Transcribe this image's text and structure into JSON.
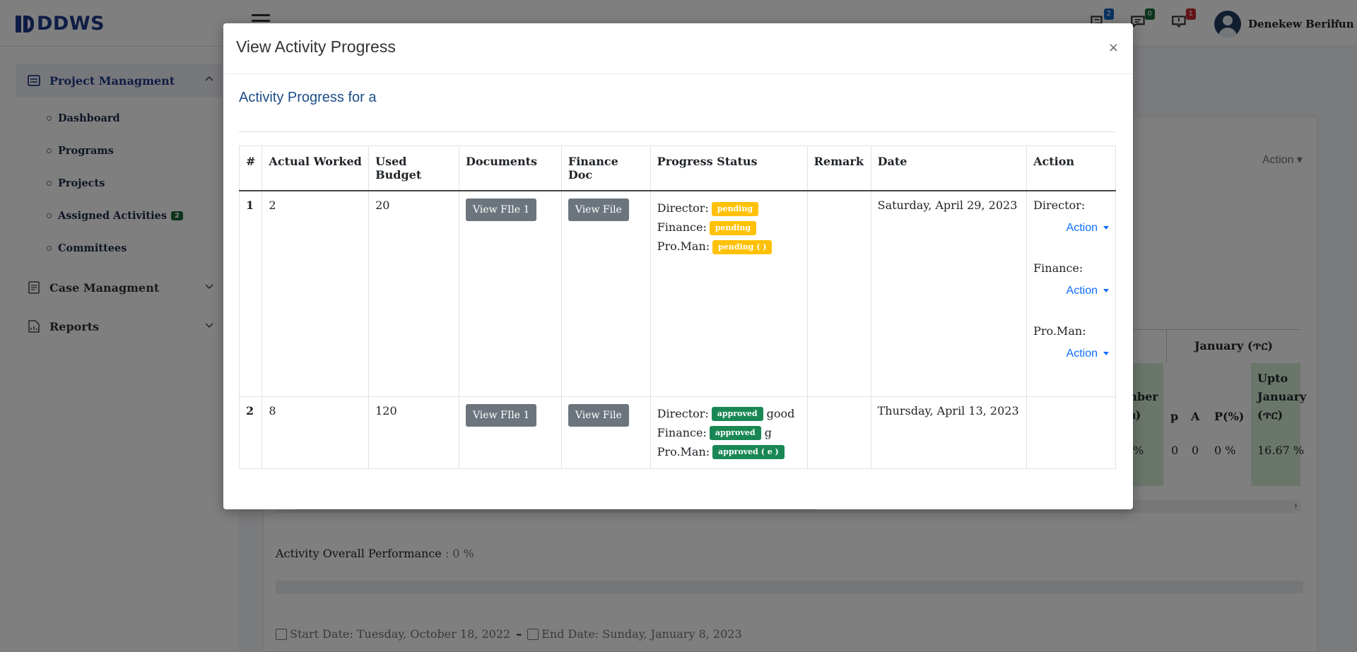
{
  "header": {
    "brand": "DDWS",
    "icons": [
      {
        "name": "chat-icon",
        "badge": "2",
        "color": "#1565c0"
      },
      {
        "name": "message-icon",
        "badge": "0",
        "color": "#1b6b37"
      },
      {
        "name": "notification-icon",
        "badge": "1",
        "color": "#c62828"
      }
    ],
    "user_name": "Denekew Berihun"
  },
  "sidebar": {
    "groups": [
      {
        "label": "Project Managment",
        "icon": "list-icon",
        "expanded": true
      },
      {
        "label": "Case Managment",
        "icon": "document-icon",
        "expanded": false
      },
      {
        "label": "Reports",
        "icon": "report-icon",
        "expanded": false
      }
    ],
    "items": [
      {
        "label": "Dashboard"
      },
      {
        "label": "Programs"
      },
      {
        "label": "Projects"
      },
      {
        "label": "Assigned Activities",
        "badge": "2"
      },
      {
        "label": "Committees"
      }
    ]
  },
  "background": {
    "action_label": "Action",
    "month_header": "January (ጥር)",
    "paren_header": ")",
    "col_number": "mber",
    "col_number2": "ክ)",
    "col_p": "p",
    "col_a": "A",
    "col_ppct": "P(%)",
    "col_upto_1": "Upto",
    "col_upto_2": "January",
    "col_upto_3": "(ጥር)",
    "val_pct1": "%",
    "val_p": "0",
    "val_a": "0",
    "val_ppct": "0 %",
    "val_upto": "16.67 %",
    "perf_label": "Activity Overall Performance",
    "perf_value": ": 0 %",
    "start_date": "Start Date: Tuesday, October 18, 2022",
    "end_date": "End Date: Sunday, January 8, 2023"
  },
  "modal": {
    "title": "View Activity Progress",
    "close": "×",
    "subtitle": "Activity Progress for a",
    "columns": [
      "#",
      "Actual Worked",
      "Used Budget",
      "Documents",
      "Finance Doc",
      "Progress Status",
      "Remark",
      "Date",
      "Action"
    ],
    "rows": [
      {
        "num": "1",
        "actual_worked": "2",
        "used_budget": "20",
        "doc_button": "View FIle 1",
        "fin_button": "View File",
        "director_label": "Director:",
        "director_status": "pending",
        "director_comment": "",
        "finance_label": "Finance:",
        "finance_status": "pending",
        "finance_comment": "",
        "proman_label": "Pro.Man:",
        "proman_status": "pending ( )",
        "remark": "",
        "date": "Saturday, April 29, 2023",
        "action_director_label": "Director:",
        "action_finance_label": "Finance:",
        "action_proman_label": "Pro.Man:",
        "action_button": "Action"
      },
      {
        "num": "2",
        "actual_worked": "8",
        "used_budget": "120",
        "doc_button": "View FIle 1",
        "fin_button": "View File",
        "director_label": "Director:",
        "director_status": "approved",
        "director_comment": "good",
        "finance_label": "Finance:",
        "finance_status": "approved",
        "finance_comment": "g",
        "proman_label": "Pro.Man:",
        "proman_status": "approved ( e )",
        "remark": "",
        "date": "Thursday, April 13, 2023"
      }
    ]
  },
  "colors": {
    "brand": "#1f3a8a",
    "pending": "#ffc107",
    "approved": "#198754",
    "link": "#0d6efd",
    "button": "#6c757d"
  }
}
